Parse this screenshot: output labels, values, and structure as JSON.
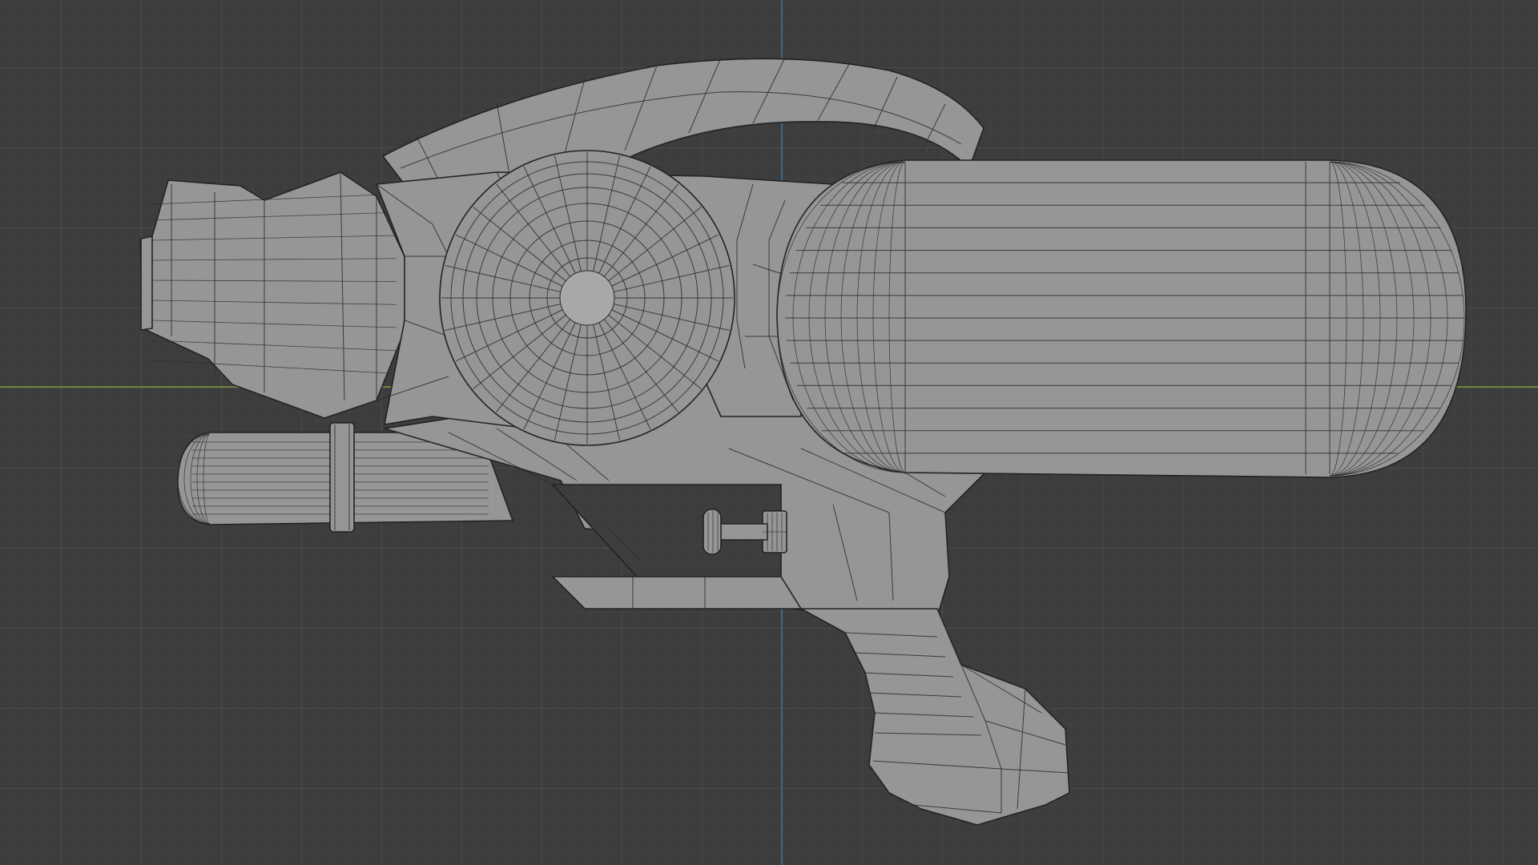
{
  "viewport": {
    "background": "#3d3d3d",
    "grid_minor_color": "#464646",
    "grid_major_color": "#545454",
    "x_axis_color": "#7a9a3a",
    "y_axis_color": "#3b77a8",
    "mesh_color": "#969696",
    "wire_color": "#2c2c2c"
  },
  "mesh": {
    "object": "water-gun",
    "parts": [
      "nozzle",
      "pump-handle",
      "top-arch",
      "pressure-dial",
      "water-tank",
      "frame",
      "trigger",
      "grip"
    ]
  }
}
